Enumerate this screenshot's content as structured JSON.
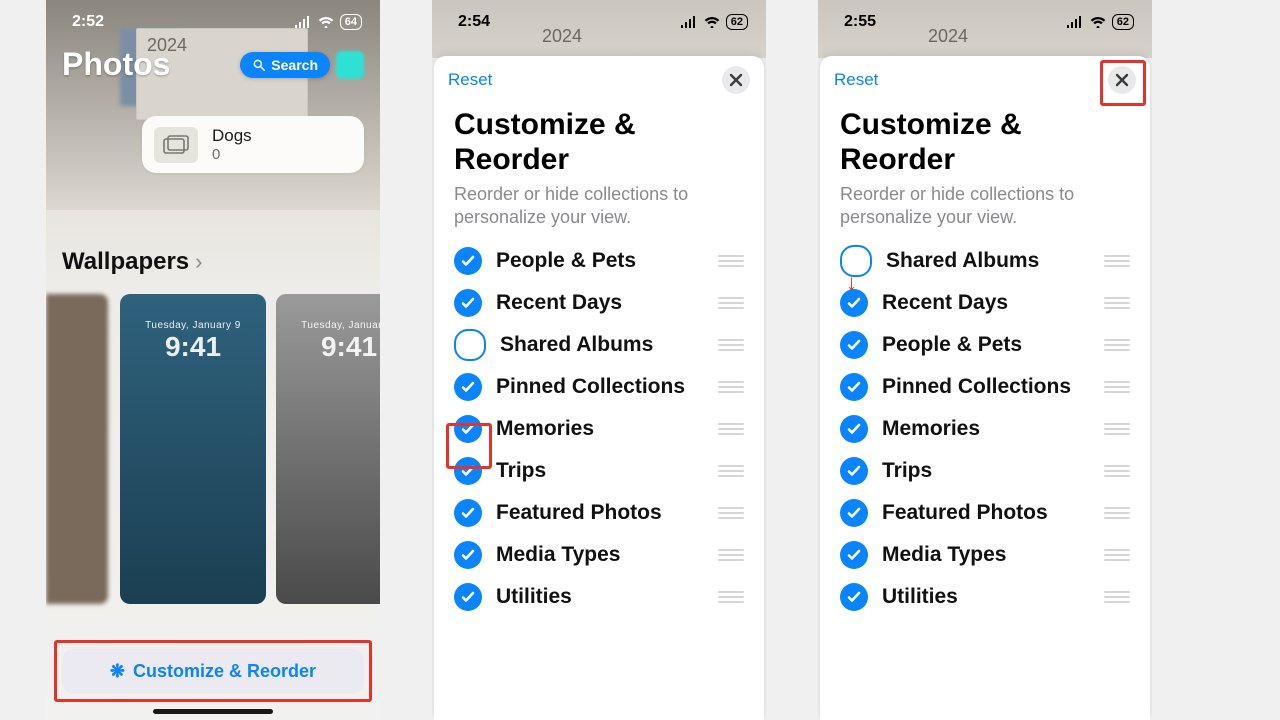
{
  "p1": {
    "status": {
      "time": "2:52",
      "battery": "64"
    },
    "title": "Photos",
    "search_label": "Search",
    "year_label": "2024",
    "dogs": {
      "title": "Dogs",
      "count": "0"
    },
    "wallpapers_title": "Wallpapers",
    "wallpaper_sample": {
      "date": "Tuesday, January 9",
      "time": "9:41"
    },
    "customize_label": "Customize & Reorder"
  },
  "p2": {
    "status": {
      "time": "2:54",
      "battery": "62"
    },
    "year_label": "2024",
    "reset_label": "Reset",
    "title": "Customize & Reorder",
    "subtitle": "Reorder or hide collections to personalize your view.",
    "items": [
      {
        "label": "People & Pets",
        "checked": true
      },
      {
        "label": "Recent Days",
        "checked": true
      },
      {
        "label": "Shared Albums",
        "checked": false
      },
      {
        "label": "Pinned Collections",
        "checked": true
      },
      {
        "label": "Memories",
        "checked": true
      },
      {
        "label": "Trips",
        "checked": true
      },
      {
        "label": "Featured Photos",
        "checked": true
      },
      {
        "label": "Media Types",
        "checked": true
      },
      {
        "label": "Utilities",
        "checked": true
      }
    ]
  },
  "p3": {
    "status": {
      "time": "2:55",
      "battery": "62"
    },
    "year_label": "2024",
    "reset_label": "Reset",
    "title": "Customize & Reorder",
    "subtitle": "Reorder or hide collections to personalize your view.",
    "items": [
      {
        "label": "Shared Albums",
        "checked": false
      },
      {
        "label": "Recent Days",
        "checked": true
      },
      {
        "label": "People & Pets",
        "checked": true
      },
      {
        "label": "Pinned Collections",
        "checked": true
      },
      {
        "label": "Memories",
        "checked": true
      },
      {
        "label": "Trips",
        "checked": true
      },
      {
        "label": "Featured Photos",
        "checked": true
      },
      {
        "label": "Media Types",
        "checked": true
      },
      {
        "label": "Utilities",
        "checked": true
      }
    ]
  }
}
